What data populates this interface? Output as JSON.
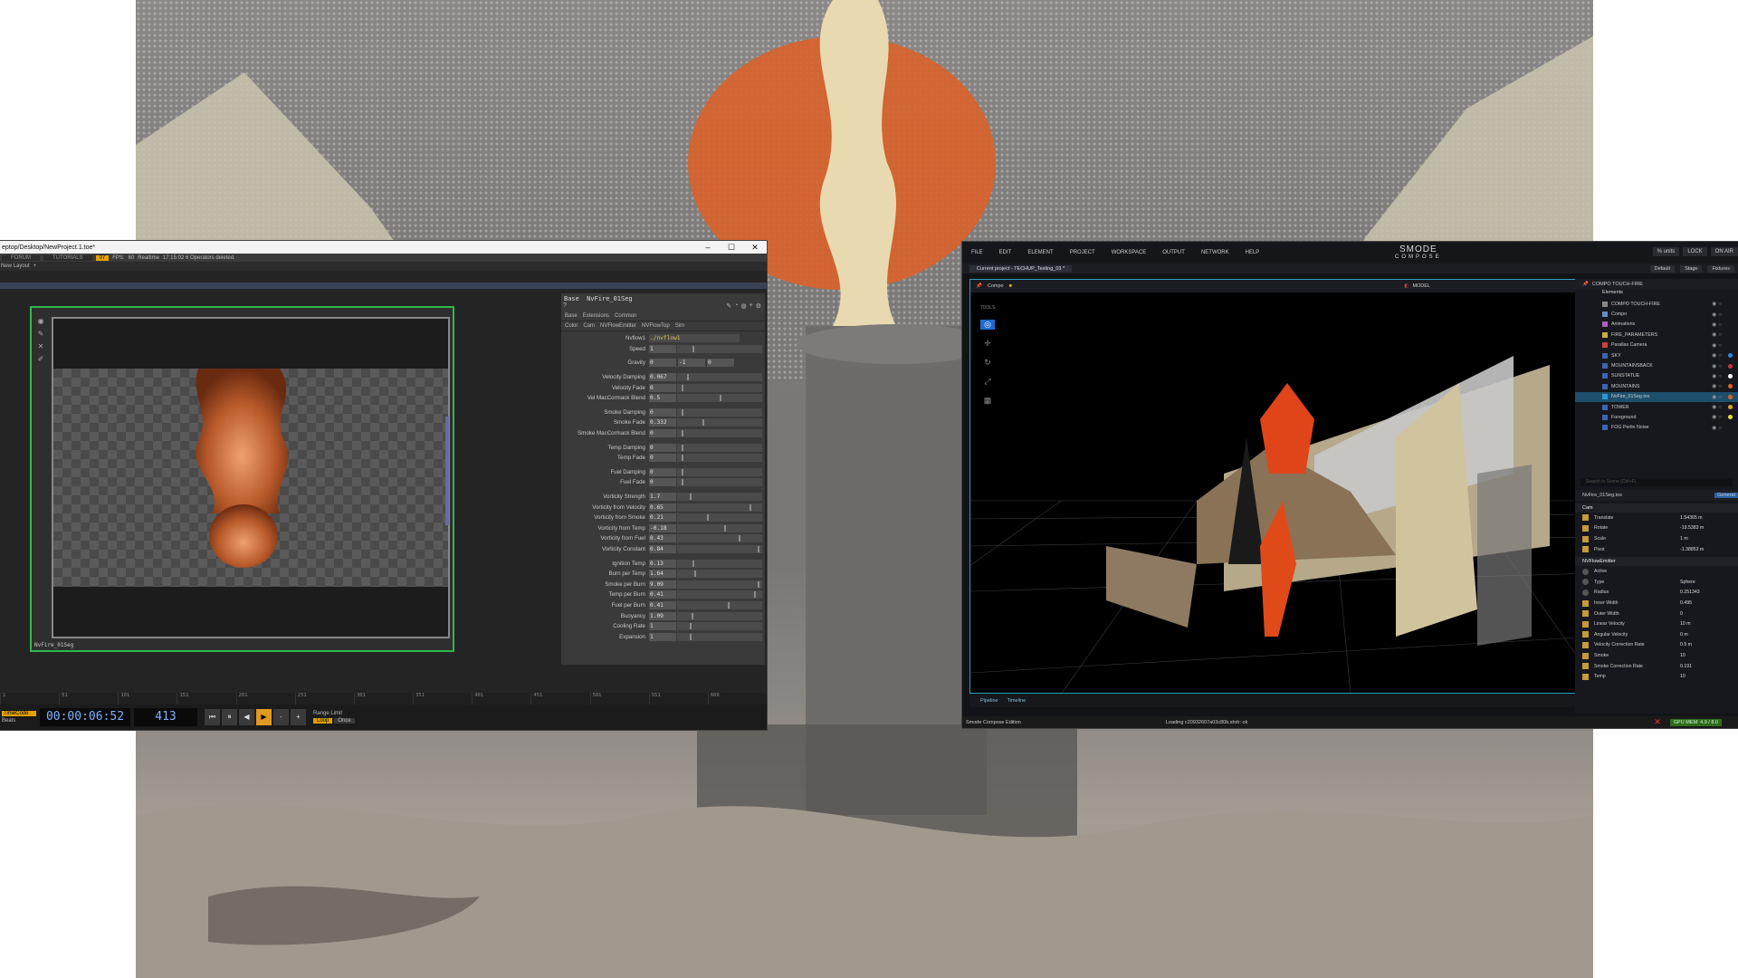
{
  "touchdesigner": {
    "title": "eptop/Desktop/NewProject.1.toe*",
    "window_controls": [
      "–",
      "☐",
      "✕"
    ],
    "menubar": {
      "forum": "FORUM",
      "tutorials": "TUTORIALS",
      "error_badge": "07",
      "fps_label": "FPS:",
      "fps_value": "60",
      "realtime": "Realtime",
      "status": "17:15:02 6 Operators deleted."
    },
    "pane_label": "New Layout",
    "viewer_label": "NvFire_01Seg",
    "params": {
      "op_type": "Base",
      "op_name": "NvFire_01Seg",
      "tabs1": [
        "Base",
        "Extensions",
        "Common"
      ],
      "tabs2": [
        "Color",
        "Cam",
        "NVFlowEmitter",
        "NVFlowTop",
        "Sim"
      ],
      "rows": [
        {
          "l": "Nvflow1",
          "v": "./nvflow1",
          "s": null,
          "g": false
        },
        {
          "l": "Speed",
          "v": "1",
          "s": 0.18,
          "g": false
        },
        {
          "l": "Gravity",
          "v": "0",
          "s": null,
          "g": true,
          "extra": [
            "-1",
            "0"
          ]
        },
        {
          "l": "Velocity Damping",
          "v": "0.067",
          "s": 0.12,
          "g": true
        },
        {
          "l": "Velocity Fade",
          "v": "0",
          "s": 0.05,
          "g": false
        },
        {
          "l": "Vel MacCormack Blend",
          "v": "0.5",
          "s": 0.5,
          "g": false
        },
        {
          "l": "Smoke Damping",
          "v": "0",
          "s": 0.05,
          "g": true
        },
        {
          "l": "Smoke Fade",
          "v": "0.332",
          "s": 0.3,
          "g": false
        },
        {
          "l": "Smoke MacCormack Blend",
          "v": "0",
          "s": 0.05,
          "g": false
        },
        {
          "l": "Temp Damping",
          "v": "0",
          "s": 0.05,
          "g": true
        },
        {
          "l": "Temp Fade",
          "v": "0",
          "s": 0.05,
          "g": false
        },
        {
          "l": "Fuel Damping",
          "v": "0",
          "s": 0.05,
          "g": true
        },
        {
          "l": "Fuel Fade",
          "v": "0",
          "s": 0.05,
          "g": false
        },
        {
          "l": "Vorticity Strength",
          "v": "1.7",
          "s": 0.15,
          "g": true
        },
        {
          "l": "Vorticity from Velocity",
          "v": "0.65",
          "s": 0.85,
          "g": false
        },
        {
          "l": "Vorticity from Smoke",
          "v": "0.21",
          "s": 0.35,
          "g": false
        },
        {
          "l": "Vorticity from Temp",
          "v": "-0.18",
          "s": 0.55,
          "g": false
        },
        {
          "l": "Vorticity from Fuel",
          "v": "0.43",
          "s": 0.72,
          "g": false
        },
        {
          "l": "Vorticity Constant",
          "v": "0.84",
          "s": 0.95,
          "g": false
        },
        {
          "l": "Ignition Temp",
          "v": "0.13",
          "s": 0.18,
          "g": true
        },
        {
          "l": "Burn per Temp",
          "v": "1.64",
          "s": 0.2,
          "g": false
        },
        {
          "l": "Smoke per Burn",
          "v": "9.09",
          "s": 0.95,
          "g": false
        },
        {
          "l": "Temp per Burn",
          "v": "0.41",
          "s": 0.9,
          "g": false
        },
        {
          "l": "Fuel per Burn",
          "v": "0.41",
          "s": 0.6,
          "g": false
        },
        {
          "l": "Buoyancy",
          "v": "1.09",
          "s": 0.17,
          "g": false
        },
        {
          "l": "Cooling Rate",
          "v": "1",
          "s": 0.15,
          "g": false
        },
        {
          "l": "Expansion",
          "v": "1",
          "s": 0.15,
          "g": false
        }
      ]
    },
    "ruler": [
      "1",
      "51",
      "101",
      "151",
      "201",
      "251",
      "301",
      "351",
      "401",
      "451",
      "501",
      "551",
      "600"
    ],
    "timebar": {
      "timecode": "TimeCode",
      "beats": "Beats",
      "time": "00:00:06:52",
      "frame": "413",
      "range_limit": "Range Limit",
      "loop": "Loop",
      "once": "Once",
      "buttons": [
        "⏮",
        "⏸",
        "◀",
        "▶",
        "-",
        "+"
      ]
    }
  },
  "smode": {
    "menu": [
      "FILE",
      "EDIT",
      "ELEMENT",
      "PROJECT",
      "WORKSPACE",
      "OUTPUT",
      "NETWORK",
      "HELP"
    ],
    "logo_top": "SMODE",
    "logo_bottom": "COMPOSE",
    "top_right": [
      "% units",
      "LOCK",
      "ON AIR"
    ],
    "project_tab": "Current project - TECHUP_Testing_03 *",
    "project_right": [
      "Default",
      "Stage",
      "Fixtures"
    ],
    "viewport_label": "Compo",
    "model_label": "MODEL",
    "tools_label": "TOOLS",
    "bottom_tabs": [
      "Pipeline",
      "Timeline"
    ],
    "status": {
      "edition": "Smode Compose Edition",
      "loading": "Loading c20932607a03c80b.shdr: ok",
      "gpu": "GPU MEM: 4.9 / 8.0"
    },
    "side": {
      "header": "COMPO TOUCH-FIRE",
      "elements_title": "Elements",
      "tree": [
        {
          "n": "COMPO TOUCH-FIRE",
          "c": "#888",
          "d": ""
        },
        {
          "n": "Compo",
          "c": "#6a8ac8",
          "d": ""
        },
        {
          "n": "Animations",
          "c": "#b05cc0",
          "d": ""
        },
        {
          "n": "FIRE_PARAMETERS",
          "c": "#c8b040",
          "d": ""
        },
        {
          "n": "Parallax Camera",
          "c": "#d04040",
          "d": ""
        },
        {
          "n": "SKY",
          "c": "#3c64b0",
          "d": "#2a8adf"
        },
        {
          "n": "MOUNTAINSBACK",
          "c": "#3c64b0",
          "d": "#d03030"
        },
        {
          "n": "SUNSTATUE",
          "c": "#3c64b0",
          "d": "#ffffff"
        },
        {
          "n": "MOUNTAINS",
          "c": "#3c64b0",
          "d": "#e06020"
        },
        {
          "n": "NvFire_01Seg.tox",
          "c": "#2a9ad0",
          "d": "#e06020"
        },
        {
          "n": "TOWER",
          "c": "#3c64b0",
          "d": "#e0a020"
        },
        {
          "n": "Foreground",
          "c": "#3c64b0",
          "d": "#e0e020"
        },
        {
          "n": "FOG Perlin Noise",
          "c": "#3c64b0",
          "d": ""
        }
      ],
      "search_placeholder": "Search in Scene (Ctrl+F)",
      "inspector_header": "NvFire_01Seg.tox",
      "inspector_right": "Generat",
      "cam_title": "Cam",
      "cam": [
        {
          "n": "Translate",
          "v": "1.54365 m"
        },
        {
          "n": "Rotate",
          "v": "-19.5383 m"
        },
        {
          "n": "Scale",
          "v": "1 m"
        },
        {
          "n": "Pivot",
          "v": "-1.38853 m"
        }
      ],
      "emitter_title": "NVFlowEmitter",
      "emitter": [
        {
          "n": "Active",
          "v": ""
        },
        {
          "n": "Type",
          "v": "Sphere"
        },
        {
          "n": "Radius",
          "v": "0.251343"
        },
        {
          "n": "Inner Width",
          "v": "0.495"
        },
        {
          "n": "Outer Width",
          "v": "0"
        },
        {
          "n": "Linear Velocity",
          "v": "10 m"
        },
        {
          "n": "Angular Velocity",
          "v": "0 m"
        },
        {
          "n": "Velocity Correction Rate",
          "v": "0.5 m"
        },
        {
          "n": "Smoke",
          "v": "10"
        },
        {
          "n": "Smoke Correction Rate",
          "v": "0.191"
        },
        {
          "n": "Temp",
          "v": "10"
        }
      ]
    }
  }
}
